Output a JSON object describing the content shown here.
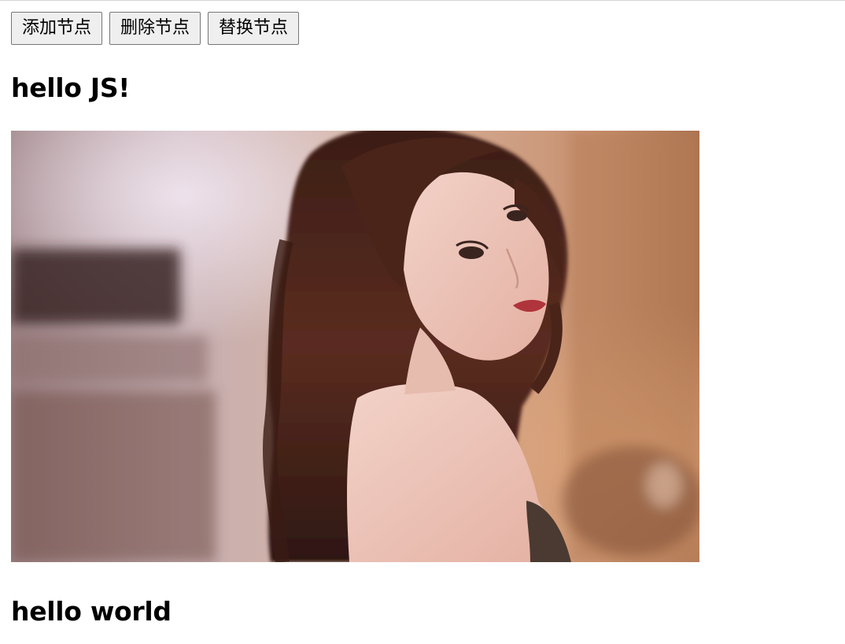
{
  "toolbar": {
    "add_label": "添加节点",
    "remove_label": "删除节点",
    "replace_label": "替换节点"
  },
  "headings": {
    "first": "hello JS!",
    "second": "hello world"
  },
  "image": {
    "description_name": "portrait-photo"
  }
}
